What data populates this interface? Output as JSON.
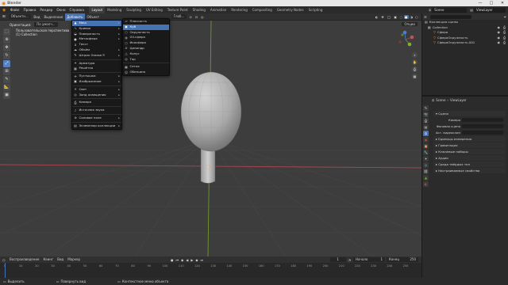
{
  "window": {
    "title": "Blender",
    "controls": [
      "—",
      "□",
      "✕"
    ]
  },
  "menubar": {
    "items": [
      "Файл",
      "Правка",
      "Рендер",
      "Окно",
      "Справка"
    ],
    "workspaces": [
      "Layout",
      "Modeling",
      "Sculpting",
      "UV Editing",
      "Texture Paint",
      "Shading",
      "Animation",
      "Rendering",
      "Compositing",
      "Geometry Nodes",
      "Scripting"
    ],
    "active_workspace": "Layout",
    "scene": "Scene",
    "view_layer": "ViewLayer"
  },
  "viewport_header": {
    "mode": "Объектн...",
    "items": [
      "Вид",
      "Выделение",
      "Добавить",
      "Объект"
    ],
    "open_menu": "Добавить",
    "orientation_label": "Ориентация:",
    "orientation_value": "По умолч...",
    "transform": "Глоб...",
    "options": "Опции"
  },
  "viewport": {
    "view_name": "Пользовательская перспектива",
    "collection_label": "(1) Collection"
  },
  "toolbar": {
    "tools": [
      "select",
      "cursor",
      "move",
      "rotate",
      "scale",
      "transform",
      "annotate",
      "measure",
      "add-cube"
    ]
  },
  "add_menu": {
    "items": [
      {
        "label": "Меш",
        "icon": "mesh-icon",
        "submenu": true,
        "hl": true
      },
      {
        "label": "Кривая",
        "icon": "curve-icon",
        "submenu": true
      },
      {
        "label": "Поверхность",
        "icon": "surface-icon",
        "submenu": true
      },
      {
        "label": "Метасфера",
        "icon": "metaball-icon",
        "submenu": true
      },
      {
        "label": "Текст",
        "icon": "text-icon",
        "submenu": false
      },
      {
        "label": "Объём",
        "icon": "volume-icon",
        "submenu": true
      },
      {
        "label": "Штрих Grease P.",
        "icon": "grease-pencil-icon",
        "submenu": true
      },
      {
        "sep": true
      },
      {
        "label": "Арматура",
        "icon": "armature-icon",
        "submenu": false
      },
      {
        "label": "Решётка",
        "icon": "lattice-icon",
        "submenu": false
      },
      {
        "sep": true
      },
      {
        "label": "Пустышка",
        "icon": "empty-icon",
        "submenu": true
      },
      {
        "label": "Изображение",
        "icon": "image-icon",
        "submenu": true
      },
      {
        "sep": true
      },
      {
        "label": "Свет",
        "icon": "light-icon",
        "submenu": true
      },
      {
        "label": "Зонд освещения",
        "icon": "light-probe-icon",
        "submenu": true
      },
      {
        "sep": true
      },
      {
        "label": "Камера",
        "icon": "camera-icon",
        "submenu": false
      },
      {
        "sep": true
      },
      {
        "label": "Источник звука",
        "icon": "speaker-icon",
        "submenu": false
      },
      {
        "sep": true
      },
      {
        "label": "Силовое поле",
        "icon": "force-field-icon",
        "submenu": true
      },
      {
        "sep": true
      },
      {
        "label": "Экземпляр коллекции",
        "icon": "collection-instance-icon",
        "submenu": true
      }
    ]
  },
  "mesh_submenu": {
    "items": [
      {
        "label": "Плоскость",
        "icon": "plane-icon"
      },
      {
        "label": "Куб",
        "icon": "cube-icon",
        "hl": true
      },
      {
        "label": "Окружность",
        "icon": "circle-icon"
      },
      {
        "label": "UV-сфера",
        "icon": "uv-sphere-icon"
      },
      {
        "label": "Икосфера",
        "icon": "ico-sphere-icon"
      },
      {
        "label": "Цилиндр",
        "icon": "cylinder-icon"
      },
      {
        "label": "Конус",
        "icon": "cone-icon"
      },
      {
        "label": "Тор",
        "icon": "torus-icon"
      },
      {
        "sep": true
      },
      {
        "label": "Сетка",
        "icon": "grid-icon"
      },
      {
        "label": "Обезьяна",
        "icon": "monkey-icon"
      }
    ]
  },
  "timeline": {
    "items": [
      "Воспроизведение",
      "Кеинг",
      "Вид",
      "Маркер"
    ],
    "current_frame": "1",
    "start_label": "Начало",
    "start": "1",
    "end_label": "Конец",
    "end": "250",
    "ticks": [
      "0",
      "10",
      "20",
      "30",
      "40",
      "50",
      "60",
      "70",
      "80",
      "90",
      "100",
      "110",
      "120",
      "130",
      "140",
      "150",
      "160",
      "170",
      "180",
      "190",
      "200",
      "210",
      "220",
      "230",
      "240",
      "250"
    ]
  },
  "statusbar": {
    "select": "Выделить",
    "rotate": "Повернуть вид",
    "context": "Контекстное меню объекта"
  },
  "outliner": {
    "title": "Коллекция сцены",
    "items": [
      {
        "label": "Collection",
        "indent": 0,
        "icon": "collection-icon"
      },
      {
        "label": "Сфера",
        "indent": 1,
        "icon": "mesh-object-icon"
      },
      {
        "label": "СфераОкружность",
        "indent": 1,
        "icon": "mesh-object-icon"
      },
      {
        "label": "СфераОкружность.001",
        "indent": 1,
        "icon": "mesh-object-icon"
      }
    ]
  },
  "properties": {
    "scene_label": "Scene",
    "view_layer": "ViewLayer",
    "panel": "Сцена",
    "fields": [
      {
        "label": "Камера"
      },
      {
        "label": "Фоновая сцена"
      },
      {
        "label": "Акт. видеоклип"
      }
    ],
    "sections": [
      "Единицы измерения",
      "Гравитация",
      "Ключевые наборы",
      "Аудио",
      "Среда твёрдых тел",
      "Настраиваемые свойства"
    ]
  },
  "colors": {
    "accent": "#4772b3",
    "viewport_bg": "#3d3d3d",
    "x_axis": "#a64651",
    "y_axis": "#6d9a2a",
    "selection_outline": "#e8934a"
  }
}
